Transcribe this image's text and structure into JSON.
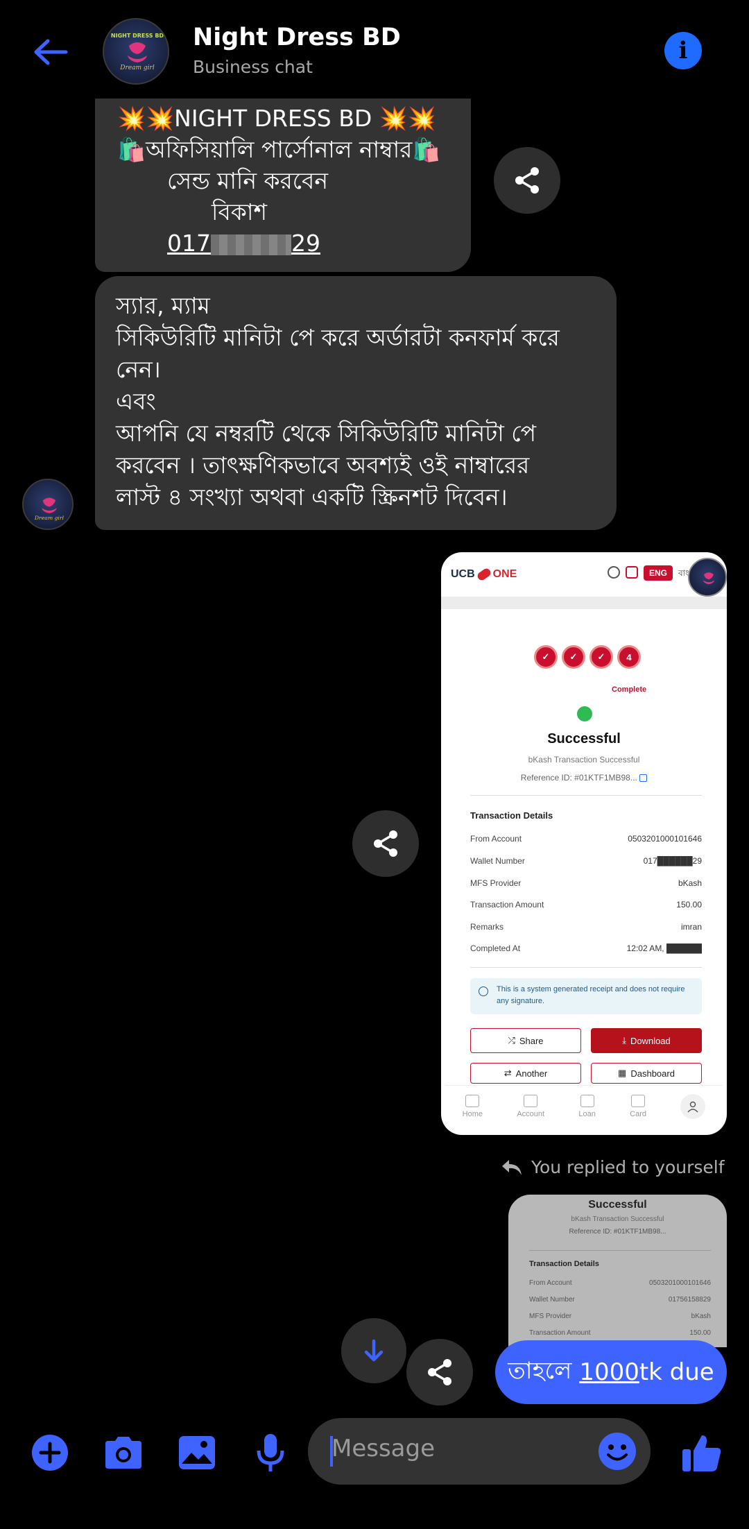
{
  "header": {
    "title": "Night Dress BD",
    "subtitle": "Business chat",
    "avatar_caption_top": "NIGHT DRESS BD",
    "avatar_caption_bottom": "Dream girl"
  },
  "messages": {
    "payment_info": {
      "line1": "💥💥NIGHT DRESS BD 💥💥",
      "line2": "🛍️অফিসিয়ালি পার্সোনাল নাম্বার🛍️",
      "line3": "সেন্ড মানি করবেন",
      "line4": "বিকাশ",
      "number_prefix": "017",
      "number_suffix": "29"
    },
    "instruction": {
      "line1": "স্যার, ম্যাম",
      "line2": "সিকিউরিটি মানিটা পে করে অর্ডারটা কনফার্ম করে",
      "line3": "নেন।",
      "line4": "এবং",
      "line5": "আপনি যে নম্বরটি থেকে সিকিউরিটি মানিটা পে",
      "line6": "করবেন । তাৎক্ষণিকভাবে অবশ্যই ওই নাম্বারের",
      "line7": "লাস্ট ৪ সংখ্যা অথবা একটি স্ক্রিনশট দিবেন।"
    }
  },
  "receipt": {
    "brand_left": "UCB",
    "brand_right": "ONE",
    "lang_pill": "ENG",
    "lang_alt": "বাং",
    "steps": [
      "",
      "",
      "",
      "4"
    ],
    "step_label": "Complete",
    "title": "Successful",
    "subtitle": "bKash Transaction Successful",
    "reference": "Reference ID: #01KTF1MB98...",
    "details_title": "Transaction Details",
    "rows": [
      {
        "label": "From Account",
        "value": "0503201000101646"
      },
      {
        "label": "Wallet Number",
        "value": "017██████29"
      },
      {
        "label": "MFS Provider",
        "value": "bKash"
      },
      {
        "label": "Transaction Amount",
        "value": "150.00"
      },
      {
        "label": "Remarks",
        "value": "imran"
      },
      {
        "label": "Completed At",
        "value": "12:02 AM, ██████"
      }
    ],
    "notice": "This is a system generated receipt and does not require any signature.",
    "btn_share": "Share",
    "btn_download": "Download",
    "btn_another": "Another",
    "btn_dashboard": "Dashboard",
    "nav": [
      "Home",
      "Account",
      "Loan",
      "Card"
    ]
  },
  "reply": {
    "label": "You replied to yourself",
    "preview": {
      "title": "Successful",
      "subtitle": "bKash Transaction Successful",
      "reference": "Reference ID: #01KTF1MB98...",
      "details_title": "Transaction Details",
      "rows": [
        {
          "label": "From Account",
          "value": "0503201000101646"
        },
        {
          "label": "Wallet Number",
          "value": "01756158829"
        },
        {
          "label": "MFS Provider",
          "value": "bKash"
        },
        {
          "label": "Transaction Amount",
          "value": "150.00"
        }
      ]
    },
    "text_before": "তাহলে ",
    "text_underlined": "1000",
    "text_after": "tk due"
  },
  "composer": {
    "placeholder": "Message"
  },
  "colors": {
    "accent_blue": "#3f63ff",
    "icon_blue": "#1f6bff",
    "bubble_dark": "#333333",
    "ucb_red": "#c8102e"
  }
}
